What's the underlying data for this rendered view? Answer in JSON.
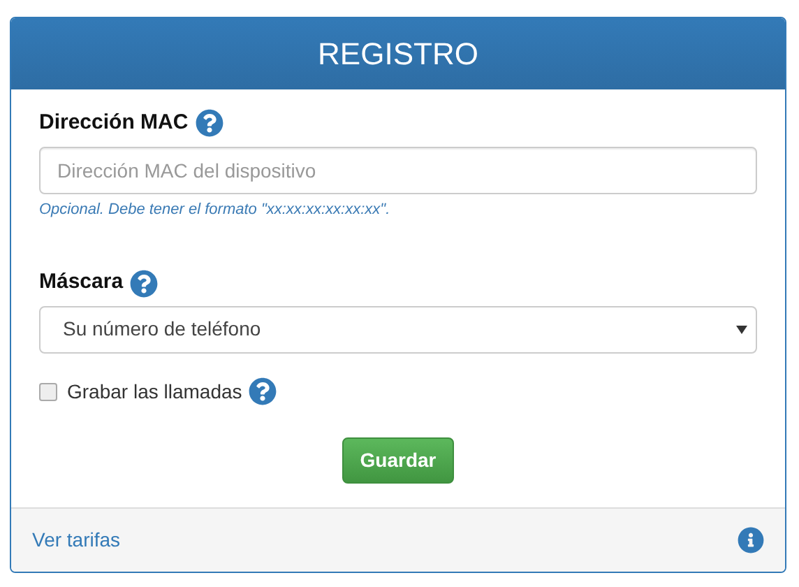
{
  "panel": {
    "title": "REGISTRO"
  },
  "mac_field": {
    "label": "Dirección MAC",
    "placeholder": "Dirección MAC del dispositivo",
    "hint": "Opcional. Debe tener el formato \"xx:xx:xx:xx:xx:xx\"."
  },
  "mask_select": {
    "label": "Máscara",
    "value": "Su número de teléfono"
  },
  "record_calls": {
    "label": "Grabar las llamadas",
    "checked": false
  },
  "save_button": {
    "label": "Guardar"
  },
  "footer": {
    "link": "Ver tarifas"
  }
}
